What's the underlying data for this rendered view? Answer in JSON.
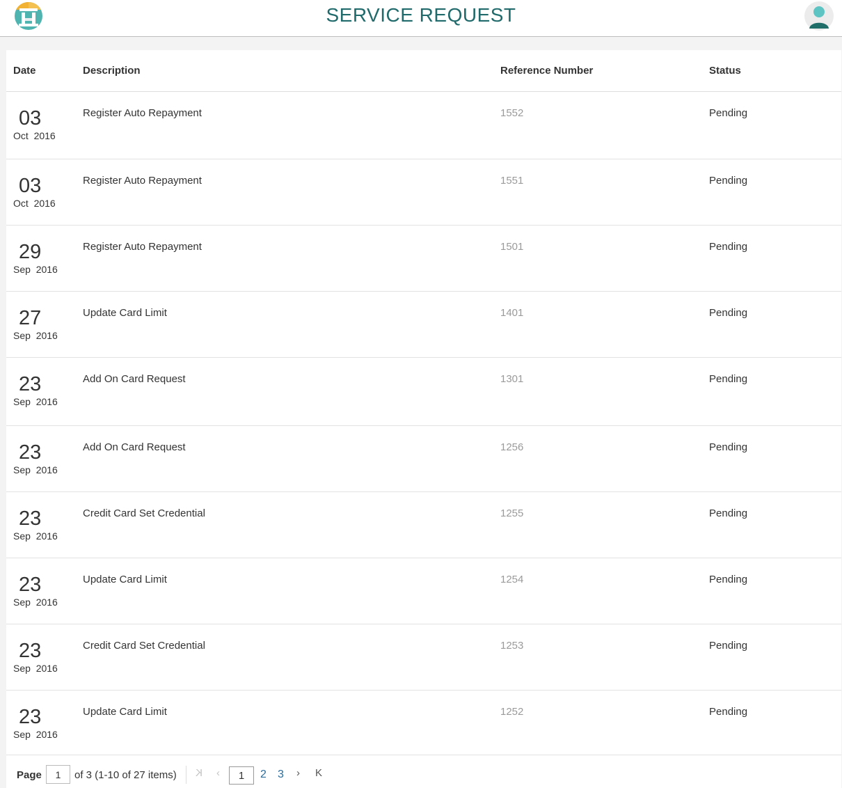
{
  "header": {
    "title": "SERVICE REQUEST",
    "logo_icon": "bank-building-logo-icon",
    "avatar_icon": "user-avatar-icon"
  },
  "table": {
    "columns": {
      "date": "Date",
      "description": "Description",
      "reference": "Reference Number",
      "status": "Status"
    },
    "rows": [
      {
        "day": "03",
        "month": "Oct",
        "year": "2016",
        "description": "Register Auto Repayment",
        "reference": "1552",
        "status": "Pending"
      },
      {
        "day": "03",
        "month": "Oct",
        "year": "2016",
        "description": "Register Auto Repayment",
        "reference": "1551",
        "status": "Pending"
      },
      {
        "day": "29",
        "month": "Sep",
        "year": "2016",
        "description": "Register Auto Repayment",
        "reference": "1501",
        "status": "Pending"
      },
      {
        "day": "27",
        "month": "Sep",
        "year": "2016",
        "description": "Update Card Limit",
        "reference": "1401",
        "status": "Pending"
      },
      {
        "day": "23",
        "month": "Sep",
        "year": "2016",
        "description": "Add On Card Request",
        "reference": "1301",
        "status": "Pending"
      },
      {
        "day": "23",
        "month": "Sep",
        "year": "2016",
        "description": "Add On Card Request",
        "reference": "1256",
        "status": "Pending"
      },
      {
        "day": "23",
        "month": "Sep",
        "year": "2016",
        "description": "Credit Card Set Credential",
        "reference": "1255",
        "status": "Pending"
      },
      {
        "day": "23",
        "month": "Sep",
        "year": "2016",
        "description": "Update Card Limit",
        "reference": "1254",
        "status": "Pending"
      },
      {
        "day": "23",
        "month": "Sep",
        "year": "2016",
        "description": "Credit Card Set Credential",
        "reference": "1253",
        "status": "Pending"
      },
      {
        "day": "23",
        "month": "Sep",
        "year": "2016",
        "description": "Update Card Limit",
        "reference": "1252",
        "status": "Pending"
      }
    ]
  },
  "pager": {
    "label": "Page",
    "input_value": "1",
    "info": "of 3 (1-10 of 27 items)",
    "first_icon": "K",
    "prev_icon": "‹",
    "pages": [
      "1",
      "2",
      "3"
    ],
    "current": "1",
    "next_icon": "›",
    "last_icon": "K"
  },
  "colors": {
    "title": "#216a6b",
    "link": "#2b6c9c",
    "reference_text": "#9a9a9a"
  }
}
